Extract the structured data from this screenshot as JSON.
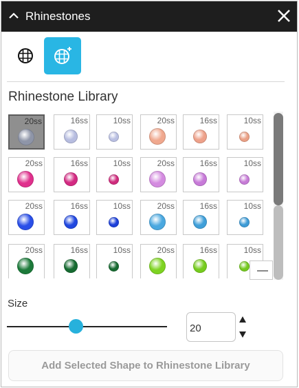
{
  "panel": {
    "title": "Rhinestones"
  },
  "toolbar": {
    "tools": [
      {
        "icon": "rhinestone-grid-icon",
        "active": false
      },
      {
        "icon": "add-rhinestone-icon",
        "active": true,
        "color": "#29b6e4"
      }
    ]
  },
  "library": {
    "title": "Rhinestone Library",
    "items": [
      {
        "size": "20ss",
        "color": "#8e95a8",
        "selected": true
      },
      {
        "size": "16ss",
        "color": "#b7bde0"
      },
      {
        "size": "10ss",
        "color": "#b9bfe2"
      },
      {
        "size": "20ss",
        "color": "#f0a88e"
      },
      {
        "size": "16ss",
        "color": "#eea18a"
      },
      {
        "size": "10ss",
        "color": "#eaa085"
      },
      {
        "size": "20ss",
        "color": "#e02f8c"
      },
      {
        "size": "16ss",
        "color": "#d32a82"
      },
      {
        "size": "10ss",
        "color": "#cf2b7d"
      },
      {
        "size": "20ss",
        "color": "#d48be0"
      },
      {
        "size": "16ss",
        "color": "#c77ad8"
      },
      {
        "size": "10ss",
        "color": "#c67bd6"
      },
      {
        "size": "20ss",
        "color": "#2a4fe8"
      },
      {
        "size": "16ss",
        "color": "#2148e0"
      },
      {
        "size": "10ss",
        "color": "#1c40d9"
      },
      {
        "size": "20ss",
        "color": "#4aa8e0"
      },
      {
        "size": "16ss",
        "color": "#3f9fd9"
      },
      {
        "size": "10ss",
        "color": "#3d9bd6"
      },
      {
        "size": "20ss",
        "color": "#1c7a3a"
      },
      {
        "size": "16ss",
        "color": "#166b31"
      },
      {
        "size": "10ss",
        "color": "#176a31"
      },
      {
        "size": "20ss",
        "color": "#7ed321"
      },
      {
        "size": "16ss",
        "color": "#76cc1e"
      },
      {
        "size": "10ss",
        "color": "#74c820"
      }
    ]
  },
  "size": {
    "label": "Size",
    "value": "20",
    "slider_fraction": 0.43
  },
  "add_button": {
    "label": "Add Selected Shape to Rhinestone Library"
  }
}
